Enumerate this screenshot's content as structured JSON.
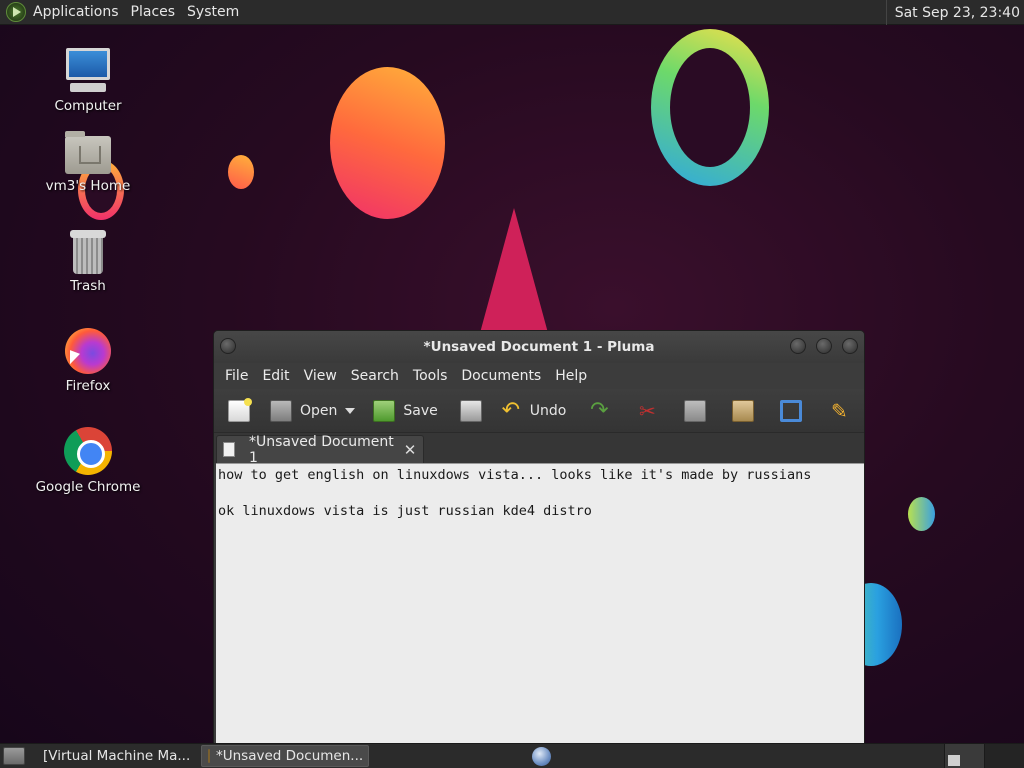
{
  "top_panel": {
    "menus": [
      "Applications",
      "Places",
      "System"
    ],
    "clock": "Sat Sep 23, 23:40"
  },
  "desktop": {
    "icons": [
      {
        "label": "Computer",
        "icon": "computer-icon"
      },
      {
        "label": "vm3's Home",
        "icon": "home-folder-icon"
      },
      {
        "label": "Trash",
        "icon": "trash-icon"
      },
      {
        "label": "Firefox",
        "icon": "firefox-icon"
      },
      {
        "label": "Google Chrome",
        "icon": "chrome-icon"
      }
    ]
  },
  "window": {
    "title": "*Unsaved Document 1 - Pluma",
    "menu": [
      "File",
      "Edit",
      "View",
      "Search",
      "Tools",
      "Documents",
      "Help"
    ],
    "toolbar": {
      "open_label": "Open",
      "save_label": "Save",
      "undo_label": "Undo"
    },
    "tab": {
      "label": "*Unsaved Document 1",
      "close": "✕"
    },
    "editor_lines": [
      "how to get english on linuxdows vista... looks like it's made by russians",
      "",
      "ok linuxdows vista is just russian kde4 distro"
    ]
  },
  "bottom_panel": {
    "tasks": [
      {
        "label": "[Virtual Machine Ma...",
        "active": false
      },
      {
        "label": "*Unsaved Documen...",
        "active": true
      }
    ]
  },
  "colors": {
    "panel": "#2b2b2b",
    "window_bg": "#3c3c3c",
    "editor_bg": "#ececec",
    "wallpaper": "#260a20"
  }
}
